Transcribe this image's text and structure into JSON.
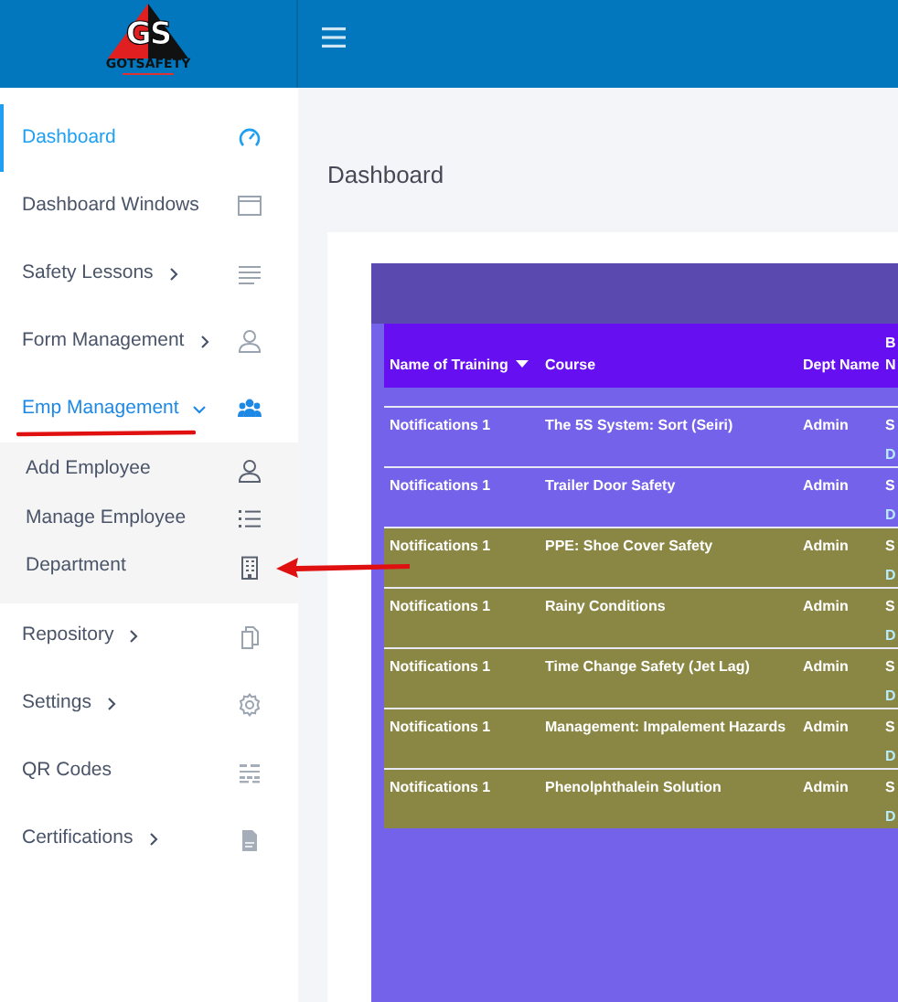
{
  "logo": {
    "mark": "GS",
    "name": "GOTSAFETY"
  },
  "sidebar": {
    "items": [
      {
        "label": "Dashboard",
        "selected": true
      },
      {
        "label": "Dashboard Windows",
        "selected": false
      },
      {
        "label": "Safety Lessons",
        "selected": false,
        "expanded": false
      },
      {
        "label": "Form Management",
        "selected": false,
        "expanded": false
      },
      {
        "label": "Emp Management",
        "selected": false,
        "expanded": true,
        "children": [
          {
            "label": "Add Employee"
          },
          {
            "label": "Manage Employee"
          },
          {
            "label": "Department"
          }
        ]
      },
      {
        "label": "Repository",
        "selected": false,
        "expanded": false
      },
      {
        "label": "Settings",
        "selected": false,
        "expanded": false
      },
      {
        "label": "QR Codes",
        "selected": false
      },
      {
        "label": "Certifications",
        "selected": false,
        "expanded": false
      }
    ]
  },
  "page_title": "Dashboard",
  "table": {
    "columns": [
      {
        "label": "Name of Training",
        "sorted": true
      },
      {
        "label": "Course",
        "sorted": false
      },
      {
        "label": "Dept Name",
        "sorted": false
      },
      {
        "label": "B N",
        "sorted": false
      }
    ],
    "rows": [
      {
        "cells": [
          "Notifications 1",
          "The 5S System: Sort (Seiri)",
          "Admin"
        ],
        "column_4": [
          "S",
          "D"
        ],
        "highlighted": false
      },
      {
        "cells": [
          "Notifications 1",
          "Trailer Door Safety",
          "Admin"
        ],
        "column_4": [
          "S",
          "D"
        ],
        "highlighted": false
      },
      {
        "cells": [
          "Notifications 1",
          "PPE: Shoe Cover Safety",
          "Admin"
        ],
        "column_4": [
          "S",
          "D"
        ],
        "highlighted": true
      },
      {
        "cells": [
          "Notifications 1",
          "Rainy Conditions",
          "Admin"
        ],
        "column_4": [
          "S",
          "D"
        ],
        "highlighted": true
      },
      {
        "cells": [
          "Notifications 1",
          "Time Change Safety (Jet Lag)",
          "Admin"
        ],
        "column_4": [
          "S",
          "D"
        ],
        "highlighted": true
      },
      {
        "cells": [
          "Notifications 1",
          "Management: Impalement Hazards",
          "Admin"
        ],
        "column_4": [
          "S",
          "D"
        ],
        "highlighted": true
      },
      {
        "cells": [
          "Notifications 1",
          "Phenolphthalein Solution",
          "Admin"
        ],
        "column_4": [
          "S",
          "D"
        ],
        "highlighted": true
      }
    ]
  }
}
